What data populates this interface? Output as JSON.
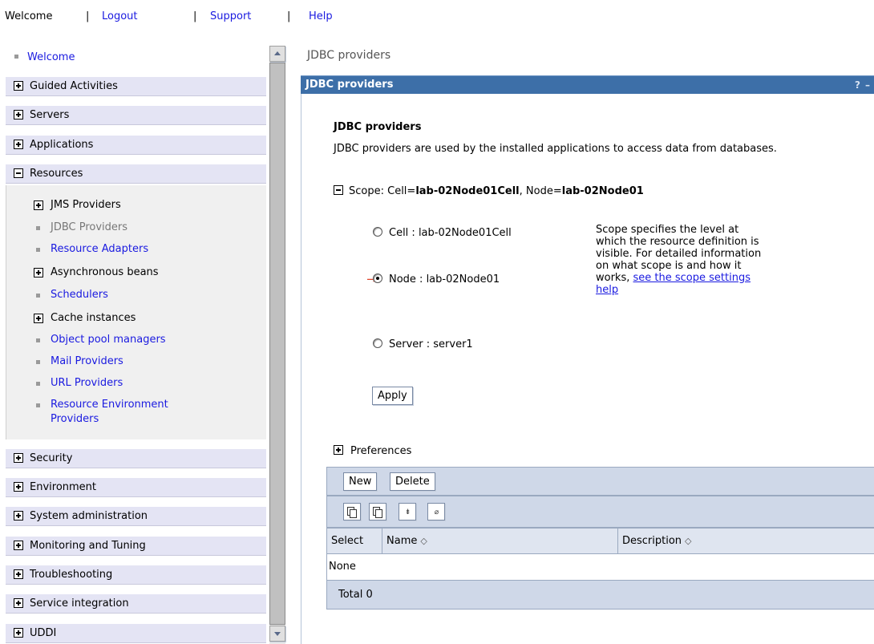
{
  "topbar": {
    "welcome": "Welcome",
    "sep": "|",
    "logout": "Logout",
    "support": "Support",
    "help": "Help"
  },
  "sidebar": {
    "welcome": "Welcome",
    "categories": [
      "Guided Activities",
      "Servers",
      "Applications",
      "Resources",
      "Security",
      "Environment",
      "System administration",
      "Monitoring and Tuning",
      "Troubleshooting",
      "Service integration",
      "UDDI"
    ],
    "resources": {
      "jms": "JMS Providers",
      "jdbc": "JDBC Providers",
      "adapters": "Resource Adapters",
      "async": "Asynchronous beans",
      "schedulers": "Schedulers",
      "cache": "Cache instances",
      "objpool": "Object pool managers",
      "mail": "Mail Providers",
      "url": "URL Providers",
      "renv1": "Resource Environment",
      "renv2": "Providers"
    }
  },
  "main": {
    "breadcrumb": "JDBC providers",
    "portlet_title": "JDBC providers",
    "help_icon": "?",
    "minimize_icon": "–",
    "heading": "JDBC providers",
    "description": "JDBC providers are used by the installed applications to access data from databases.",
    "scope": {
      "prefix": "Scope: Cell=",
      "cell": "lab-02Node01Cell",
      "mid": ", Node=",
      "node": "lab-02Node01"
    },
    "radios": [
      {
        "label": "Cell : lab-02Node01Cell",
        "selected": false
      },
      {
        "label": "Node : lab-02Node01",
        "selected": true
      },
      {
        "label": "Server : server1",
        "selected": false
      }
    ],
    "scope_help": "Scope specifies the level at which the resource definition is visible. For detailed information on what scope is and how it works,",
    "scope_help_link": "see the scope settings help",
    "apply": "Apply",
    "preferences": "Preferences",
    "table": {
      "new_label": "New",
      "delete_label": "Delete",
      "icons": [
        "select-all-icon",
        "deselect-all-icon",
        "show-filter-icon",
        "clear-filter-icon"
      ],
      "columns": [
        "Select",
        "Name",
        "Description"
      ],
      "empty_text": "None",
      "total": "Total 0"
    }
  },
  "colors": {
    "link": "#1a1ae0",
    "portlet_header": "#3d6fa8",
    "nav_category": "#e4e4f4",
    "table_band": "#cfd8e8"
  }
}
